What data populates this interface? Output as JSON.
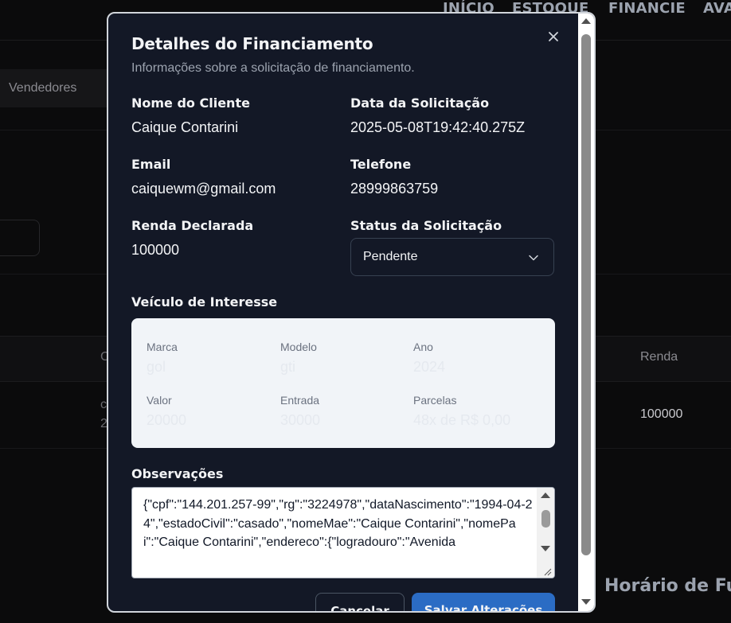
{
  "background": {
    "nav": [
      "INÍCIO",
      "ESTOQUE",
      "FINANCIE",
      "AVA"
    ],
    "subnav_label": "Vendedores",
    "table_header_first": "C",
    "table_header_renda": "Renda",
    "row_fragment_1": "c",
    "row_fragment_2": "2",
    "row_renda_value": "100000",
    "section_heading": "Horário de Fu"
  },
  "modal": {
    "title": "Detalhes do Financiamento",
    "subtitle": "Informações sobre a solicitação de financiamento.",
    "close_icon": "close-icon",
    "fields": {
      "client_name_label": "Nome do Cliente",
      "client_name_value": "Caique Contarini",
      "request_date_label": "Data da Solicitação",
      "request_date_value": "2025-05-08T19:42:40.275Z",
      "email_label": "Email",
      "email_value": "caiquewm@gmail.com",
      "phone_label": "Telefone",
      "phone_value": "28999863759",
      "income_label": "Renda Declarada",
      "income_value": "100000",
      "status_label": "Status da Solicitação",
      "status_value": "Pendente"
    },
    "vehicle": {
      "heading": "Veículo de Interesse",
      "brand_label": "Marca",
      "brand_value": "gol",
      "model_label": "Modelo",
      "model_value": "gti",
      "year_label": "Ano",
      "year_value": "2024",
      "price_label": "Valor",
      "price_value": "20000",
      "down_payment_label": "Entrada",
      "down_payment_value": "30000",
      "installments_label": "Parcelas",
      "installments_value": "48x de R$ 0,00"
    },
    "observations": {
      "label": "Observações",
      "value": "{\"cpf\":\"144.201.257-99\",\"rg\":\"3224978\",\"dataNascimento\":\"1994-04-24\",\"estadoCivil\":\"casado\",\"nomeMae\":\"Caique Contarini\",\"nomePai\":\"Caique Contarini\",\"endereco\":{\"logradouro\":\"Avenida"
    },
    "buttons": {
      "cancel": "Cancelar",
      "save": "Salvar Alterações"
    }
  },
  "colors": {
    "modal_bg": "#131826",
    "primary_button": "#2b6cc4",
    "vehicle_card_bg": "#f1f4f8"
  }
}
